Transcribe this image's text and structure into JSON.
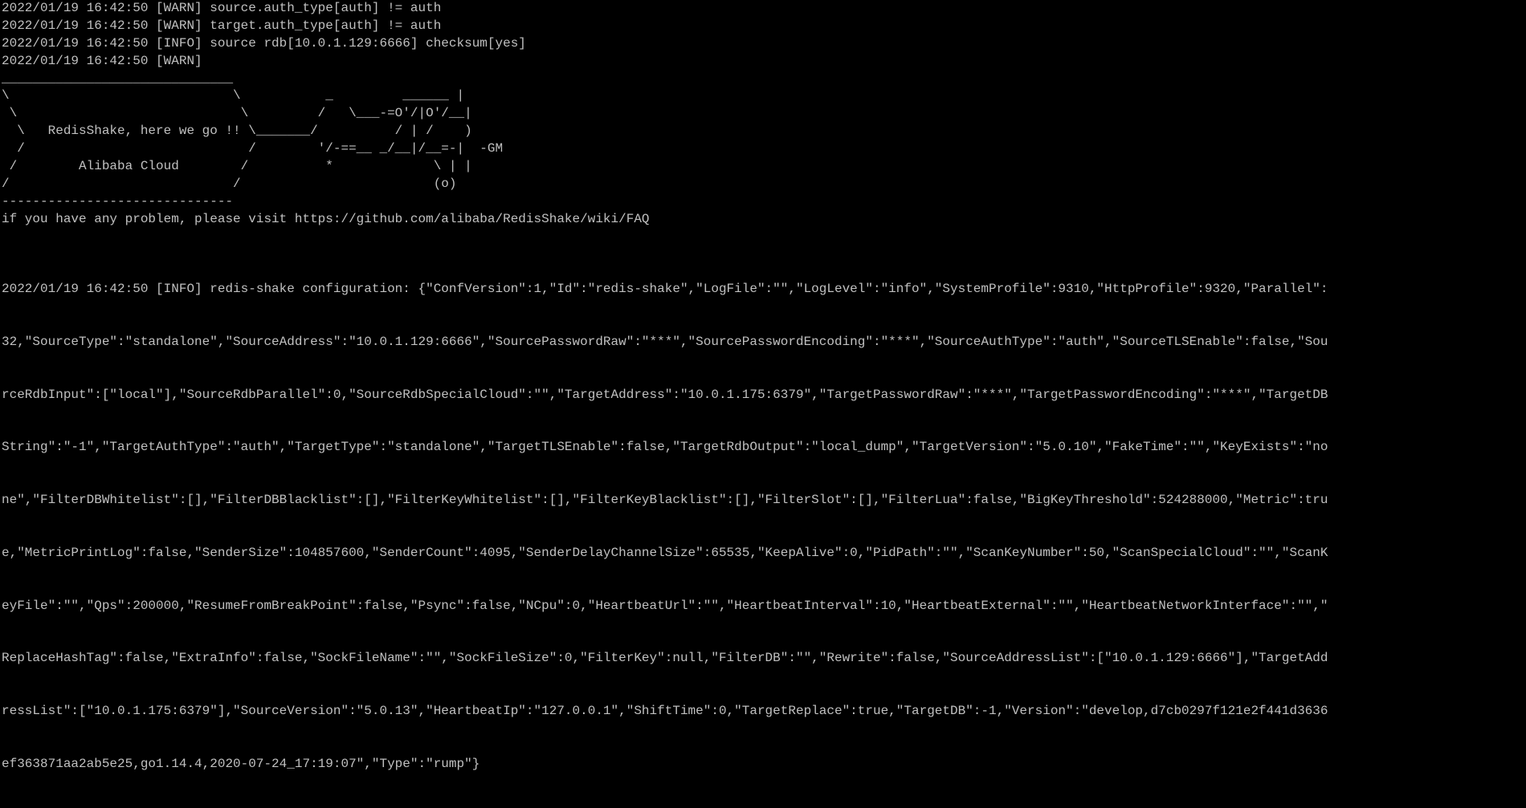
{
  "terminal": {
    "log_header": [
      "2022/01/19 16:42:50 [WARN] source.auth_type[auth] != auth",
      "2022/01/19 16:42:50 [WARN] target.auth_type[auth] != auth",
      "2022/01/19 16:42:50 [INFO] source rdb[10.0.1.129:6666] checksum[yes]",
      "2022/01/19 16:42:50 [WARN]"
    ],
    "banner": [
      "______________________________",
      "\\                             \\           _         ______ |",
      " \\                             \\         /   \\___-=O'/|O'/__|",
      "  \\   RedisShake, here we go !! \\_______/          / | /    )",
      "  /                             /        '/-==__ _/__|/__=-|  -GM",
      " /        Alibaba Cloud        /          *             \\ | |",
      "/                             /                         (o)",
      "------------------------------"
    ],
    "faq_line": "if you have any problem, please visit https://github.com/alibaba/RedisShake/wiki/FAQ",
    "config_lines": [
      "2022/01/19 16:42:50 [INFO] redis-shake configuration: {\"ConfVersion\":1,\"Id\":\"redis-shake\",\"LogFile\":\"\",\"LogLevel\":\"info\",\"SystemProfile\":9310,\"HttpProfile\":9320,\"Parallel\":",
      "32,\"SourceType\":\"standalone\",\"SourceAddress\":\"10.0.1.129:6666\",\"SourcePasswordRaw\":\"***\",\"SourcePasswordEncoding\":\"***\",\"SourceAuthType\":\"auth\",\"SourceTLSEnable\":false,\"Sou",
      "rceRdbInput\":[\"local\"],\"SourceRdbParallel\":0,\"SourceRdbSpecialCloud\":\"\",\"TargetAddress\":\"10.0.1.175:6379\",\"TargetPasswordRaw\":\"***\",\"TargetPasswordEncoding\":\"***\",\"TargetDB",
      "String\":\"-1\",\"TargetAuthType\":\"auth\",\"TargetType\":\"standalone\",\"TargetTLSEnable\":false,\"TargetRdbOutput\":\"local_dump\",\"TargetVersion\":\"5.0.10\",\"FakeTime\":\"\",\"KeyExists\":\"no",
      "ne\",\"FilterDBWhitelist\":[],\"FilterDBBlacklist\":[],\"FilterKeyWhitelist\":[],\"FilterKeyBlacklist\":[],\"FilterSlot\":[],\"FilterLua\":false,\"BigKeyThreshold\":524288000,\"Metric\":tru",
      "e,\"MetricPrintLog\":false,\"SenderSize\":104857600,\"SenderCount\":4095,\"SenderDelayChannelSize\":65535,\"KeepAlive\":0,\"PidPath\":\"\",\"ScanKeyNumber\":50,\"ScanSpecialCloud\":\"\",\"ScanK",
      "eyFile\":\"\",\"Qps\":200000,\"ResumeFromBreakPoint\":false,\"Psync\":false,\"NCpu\":0,\"HeartbeatUrl\":\"\",\"HeartbeatInterval\":10,\"HeartbeatExternal\":\"\",\"HeartbeatNetworkInterface\":\"\",\"",
      "ReplaceHashTag\":false,\"ExtraInfo\":false,\"SockFileName\":\"\",\"SockFileSize\":0,\"FilterKey\":null,\"FilterDB\":\"\",\"Rewrite\":false,\"SourceAddressList\":[\"10.0.1.129:6666\"],\"TargetAdd",
      "ressList\":[\"10.0.1.175:6379\"],\"SourceVersion\":\"5.0.13\",\"HeartbeatIp\":\"127.0.0.1\",\"ShiftTime\":0,\"TargetReplace\":true,\"TargetDB\":-1,\"Version\":\"develop,d7cb0297f121e2f441d3636",
      "ef363871aa2ab5e25,go1.14.4,2020-07-24_17:19:07\",\"Type\":\"rump\"}"
    ]
  }
}
